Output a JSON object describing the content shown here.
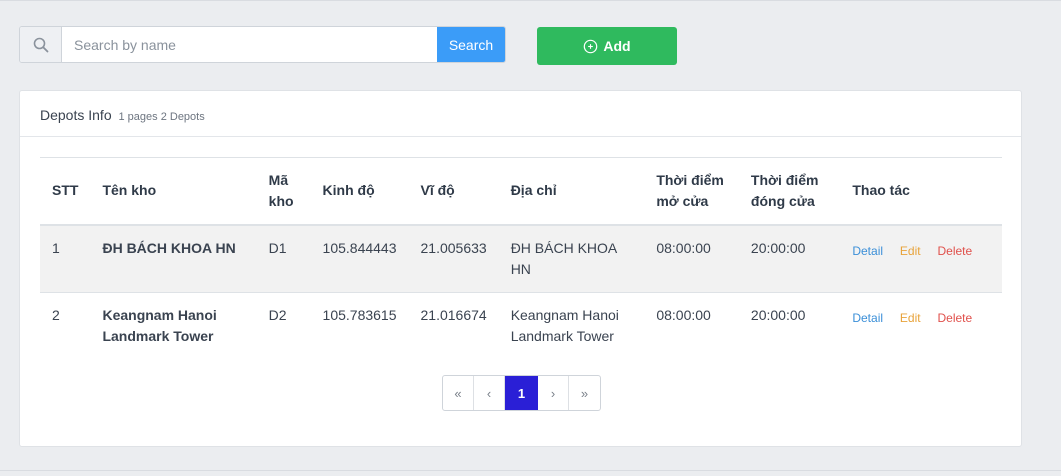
{
  "search": {
    "placeholder": "Search by name",
    "value": "",
    "button_label": "Search",
    "icon": "search-icon"
  },
  "add_button": {
    "label": "Add",
    "icon": "plus-circle-icon"
  },
  "card": {
    "title": "Depots Info",
    "subtitle": "1 pages 2 Depots"
  },
  "table": {
    "headers": {
      "stt": "STT",
      "name": "Tên kho",
      "code_line1": "Mã",
      "code_line2": "kho",
      "lng": "Kinh độ",
      "lat": "Vĩ độ",
      "address": "Địa chỉ",
      "open_line1": "Thời điểm",
      "open_line2": "mở cửa",
      "close_line1": "Thời điểm",
      "close_line2": "đóng cửa",
      "actions": "Thao tác"
    },
    "rows": [
      {
        "stt": "1",
        "name_line1": "ĐH BÁCH KHOA HN",
        "name_line2": "",
        "code": "D1",
        "lng": "105.844443",
        "lat": "21.005633",
        "address_line1": "ĐH BÁCH KHOA",
        "address_line2": "HN",
        "open": "08:00:00",
        "close": "20:00:00"
      },
      {
        "stt": "2",
        "name_line1": "Keangnam Hanoi",
        "name_line2": "Landmark Tower",
        "code": "D2",
        "lng": "105.783615",
        "lat": "21.016674",
        "address_line1": "Keangnam Hanoi",
        "address_line2": "Landmark Tower",
        "open": "08:00:00",
        "close": "20:00:00"
      }
    ],
    "actions": {
      "detail": "Detail",
      "edit": "Edit",
      "delete": "Delete"
    }
  },
  "pagination": {
    "first": "«",
    "prev": "‹",
    "current": "1",
    "next": "›",
    "last": "»"
  },
  "colors": {
    "search_button": "#3b9cf8",
    "add_button": "#2fba5e",
    "active_page": "#2a1fd6",
    "detail": "#3b8fd8",
    "edit": "#e8a33a",
    "delete": "#e0504b"
  }
}
